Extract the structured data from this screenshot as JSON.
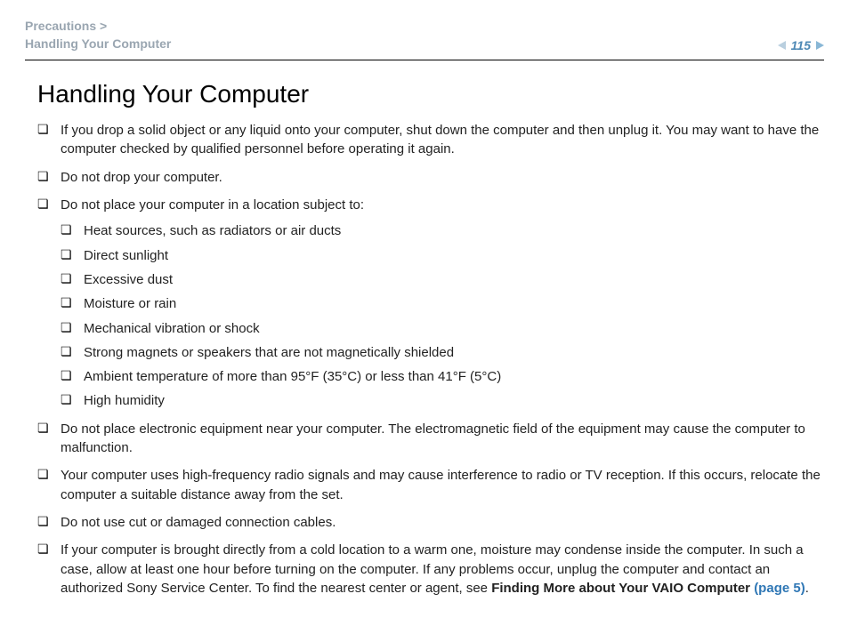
{
  "header": {
    "breadcrumb_line1": "Precautions >",
    "breadcrumb_line2": "Handling Your Computer",
    "page_number": "115",
    "prev_label": "n",
    "next_label": "N"
  },
  "title": "Handling Your Computer",
  "bullets": {
    "b0": "If you drop a solid object or any liquid onto your computer, shut down the computer and then unplug it. You may want to have the computer checked by qualified personnel before operating it again.",
    "b1": "Do not drop your computer.",
    "b2": "Do not place your computer in a location subject to:",
    "b3": "Do not place electronic equipment near your computer. The electromagnetic field of the equipment may cause the computer to malfunction.",
    "b4": "Your computer uses high-frequency radio signals and may cause interference to radio or TV reception. If this occurs, relocate the computer a suitable distance away from the set.",
    "b5": "Do not use cut or damaged connection cables.",
    "b6_pre": "If your computer is brought directly from a cold location to a warm one, moisture may condense inside the computer. In such a case, allow at least one hour before turning on the computer. If any problems occur, unplug the computer and contact an authorized Sony Service Center. To find the nearest center or agent, see ",
    "b6_strong": "Finding More about Your VAIO Computer ",
    "b6_link": "(page 5)",
    "b6_post": "."
  },
  "sub": {
    "s0": "Heat sources, such as radiators or air ducts",
    "s1": "Direct sunlight",
    "s2": "Excessive dust",
    "s3": "Moisture or rain",
    "s4": "Mechanical vibration or shock",
    "s5": "Strong magnets or speakers that are not magnetically shielded",
    "s6": "Ambient temperature of more than 95°F (35°C) or less than 41°F (5°C)",
    "s7": "High humidity"
  }
}
